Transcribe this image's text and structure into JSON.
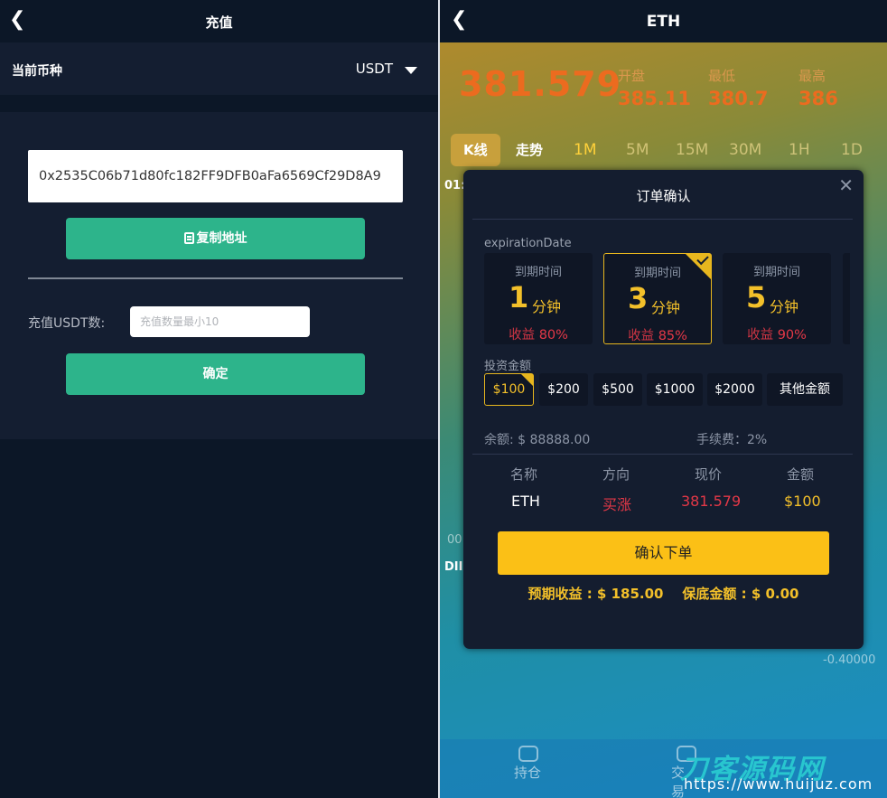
{
  "left": {
    "header_title": "充值",
    "currency_label": "当前币种",
    "currency_value": "USDT",
    "address": "0x2535C06b71d80fc182FF9DFB0aFa6569Cf29D8A9",
    "copy_button": "复制地址",
    "amount_label": "充值USDT数:",
    "amount_placeholder": "充值数量最小10",
    "confirm_button": "确定"
  },
  "right": {
    "header_title": "ETH",
    "price": "381.579",
    "stats": [
      {
        "label": "开盘",
        "value": "385.11"
      },
      {
        "label": "最低",
        "value": "380.7"
      },
      {
        "label": "最高",
        "value": "386"
      }
    ],
    "tabs": [
      "K线",
      "走势",
      "1M",
      "5M",
      "15M",
      "30M",
      "1H",
      "1D"
    ],
    "bg_labels": {
      "time": "01:",
      "dif": "DII",
      "zero": "00",
      "neg": "-0.40000"
    },
    "bottom_nav": [
      "持仓",
      "交易"
    ],
    "watermark": "刀客源码网",
    "watermark_url": "https://www.huijuz.com"
  },
  "modal": {
    "title": "订单确认",
    "expiration_label": "expirationDate",
    "options": [
      {
        "label": "到期时间",
        "num": "1",
        "unit": "分钟",
        "profit_label": "收益",
        "profit": "80%"
      },
      {
        "label": "到期时间",
        "num": "3",
        "unit": "分钟",
        "profit_label": "收益",
        "profit": "85%"
      },
      {
        "label": "到期时间",
        "num": "5",
        "unit": "分钟",
        "profit_label": "收益",
        "profit": "90%"
      }
    ],
    "amount_title": "投资金额",
    "amounts": [
      "$100",
      "$200",
      "$500",
      "$1000",
      "$2000",
      "其他金额"
    ],
    "balance": "余额: $ 88888.00",
    "fee": "手续费：2%",
    "table_headers": [
      "名称",
      "方向",
      "现价",
      "金额"
    ],
    "table_values": [
      "ETH",
      "买涨",
      "381.579",
      "$100"
    ],
    "confirm_button": "确认下单",
    "expected": "预期收益 : $ 185.00",
    "margin": "保底金额 : $ 0.00"
  },
  "colors": {
    "accent_green": "#2db48b",
    "gold": "#fbc016",
    "up_red": "#e33847",
    "orange": "#ec6b1f"
  }
}
